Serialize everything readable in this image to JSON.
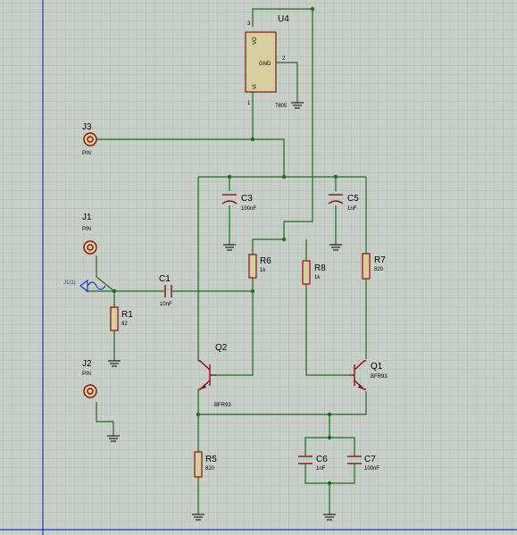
{
  "colors": {
    "background": "#c8cec8",
    "grid": "#a9b2a9",
    "grid_major": "#98a298",
    "wire": "#1f6b1f",
    "component": "#8a1010",
    "component_fill": "#d8cf9f",
    "margin_line": "#2233aa",
    "generator": "#2233cc"
  },
  "u4": {
    "ref": "U4",
    "part": "7805",
    "vo": "VO",
    "vi": "VI",
    "gnd": "GND",
    "pin1": "1",
    "pin2": "2",
    "pin3": "3"
  },
  "j3": {
    "ref": "J3",
    "type": "PIN"
  },
  "j1": {
    "ref": "J1",
    "type": "PIN"
  },
  "j2": {
    "ref": "J2",
    "type": "PIN"
  },
  "generator": {
    "label": "J1(1)"
  },
  "c1": {
    "ref": "C1",
    "value": "10nF"
  },
  "c3": {
    "ref": "C3",
    "value": "100nF"
  },
  "c5": {
    "ref": "C5",
    "value": "1nF"
  },
  "c6": {
    "ref": "C6",
    "value": "1nF"
  },
  "c7": {
    "ref": "C7",
    "value": "100nF"
  },
  "r1": {
    "ref": "R1",
    "value": "82"
  },
  "r5": {
    "ref": "R5",
    "value": "820"
  },
  "r6": {
    "ref": "R6",
    "value": "1k"
  },
  "r7": {
    "ref": "R7",
    "value": "820"
  },
  "r8": {
    "ref": "R8",
    "value": "1k"
  },
  "q1": {
    "ref": "Q1",
    "part": "BFR93"
  },
  "q2": {
    "ref": "Q2",
    "part": "BFR93"
  }
}
